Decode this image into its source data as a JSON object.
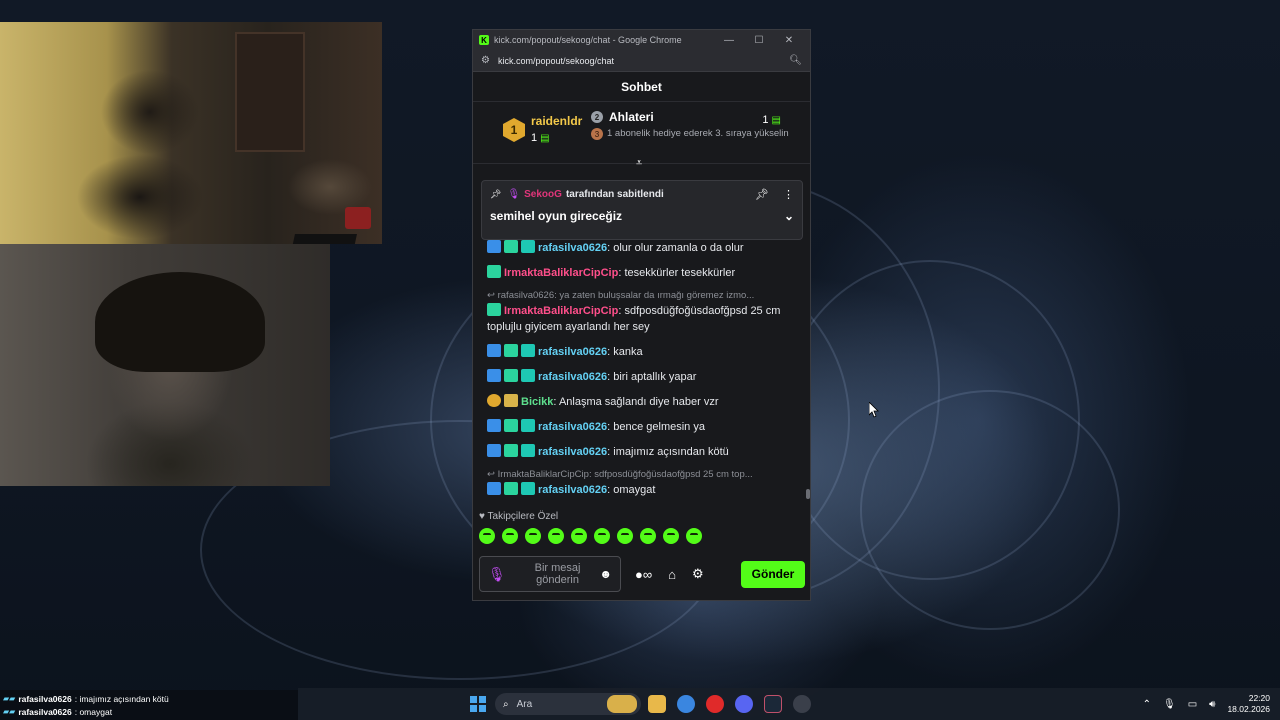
{
  "window": {
    "title": "kick.com/popout/sekoog/chat - Google Chrome",
    "url": "kick.com/popout/sekoog/chat",
    "minimize": "—",
    "maximize": "☐",
    "close": "✕"
  },
  "chat": {
    "header": "Sohbet",
    "leaderboard": {
      "first": {
        "rank": "1",
        "name": "raidenldr",
        "count": "1"
      },
      "second": {
        "rank": "2",
        "name": "Ahlateri",
        "count": "1"
      },
      "third": {
        "rank": "3",
        "text": "1 abonelik hediye ederek 3. sıraya yükselin"
      }
    },
    "pinned": {
      "user": "SekooG",
      "by_text": "tarafından sabitlendi",
      "message": "semihel oyun gireceğiz"
    },
    "messages": [
      {
        "user": "rafasilva0626",
        "text": "olur olur zamanla o da olur",
        "color": "cyan",
        "badges": [
          "hammer",
          "gift",
          "sub"
        ]
      },
      {
        "user": "IrmaktaBaliklarCipCip",
        "text": "tesekkürler tesekkürler",
        "color": "pink",
        "badges": [
          "gift"
        ]
      },
      {
        "reply": "rafasilva0626: ya zaten buluşsalar da ırmağı göremez izmo...",
        "user": "IrmaktaBaliklarCipCip",
        "text": "sdfposdüğfoğüsdaofğpsd 25 cm toplujlu giyicem ayarlandı her sey",
        "color": "pink",
        "badges": [
          "gift"
        ]
      },
      {
        "user": "rafasilva0626",
        "text": "kanka",
        "color": "cyan",
        "badges": [
          "hammer",
          "gift",
          "sub"
        ]
      },
      {
        "user": "rafasilva0626",
        "text": "biri aptallık yapar",
        "color": "cyan",
        "badges": [
          "hammer",
          "gift",
          "sub"
        ]
      },
      {
        "user": "Bicikk",
        "text": "Anlaşma sağlandı diye haber vzr",
        "color": "green",
        "badges": [
          "gold",
          "box"
        ]
      },
      {
        "user": "rafasilva0626",
        "text": "bence gelmesin ya",
        "color": "cyan",
        "badges": [
          "hammer",
          "gift",
          "sub"
        ]
      },
      {
        "user": "rafasilva0626",
        "text": "imajımız açısından kötü",
        "color": "cyan",
        "badges": [
          "hammer",
          "gift",
          "sub"
        ]
      },
      {
        "reply": "IrmaktaBaliklarCipCip: sdfposdüğfoğüsdaofğpsd 25 cm top...",
        "user": "rafasilva0626",
        "text": "omaygat",
        "color": "cyan",
        "badges": [
          "hammer",
          "gift",
          "sub"
        ]
      }
    ],
    "emote_section_label": "Takipçilere Özel",
    "input_placeholder": "Bir mesaj gönderin",
    "send_label": "Gönder",
    "infinity_label": "∞"
  },
  "overlay_chat": [
    {
      "user": "rafasilva0626",
      "text": ": imajımız açısından kötü"
    },
    {
      "user": "rafasilva0626",
      "text": ": omaygat"
    }
  ],
  "taskbar": {
    "search_label": "Ara",
    "time": "22:20",
    "date": "18.02.2026"
  },
  "colors": {
    "accent": "#53fc18",
    "cyan_user": "#64d1f4",
    "pink_user": "#ff4f8b",
    "green_user": "#5ee08e"
  }
}
